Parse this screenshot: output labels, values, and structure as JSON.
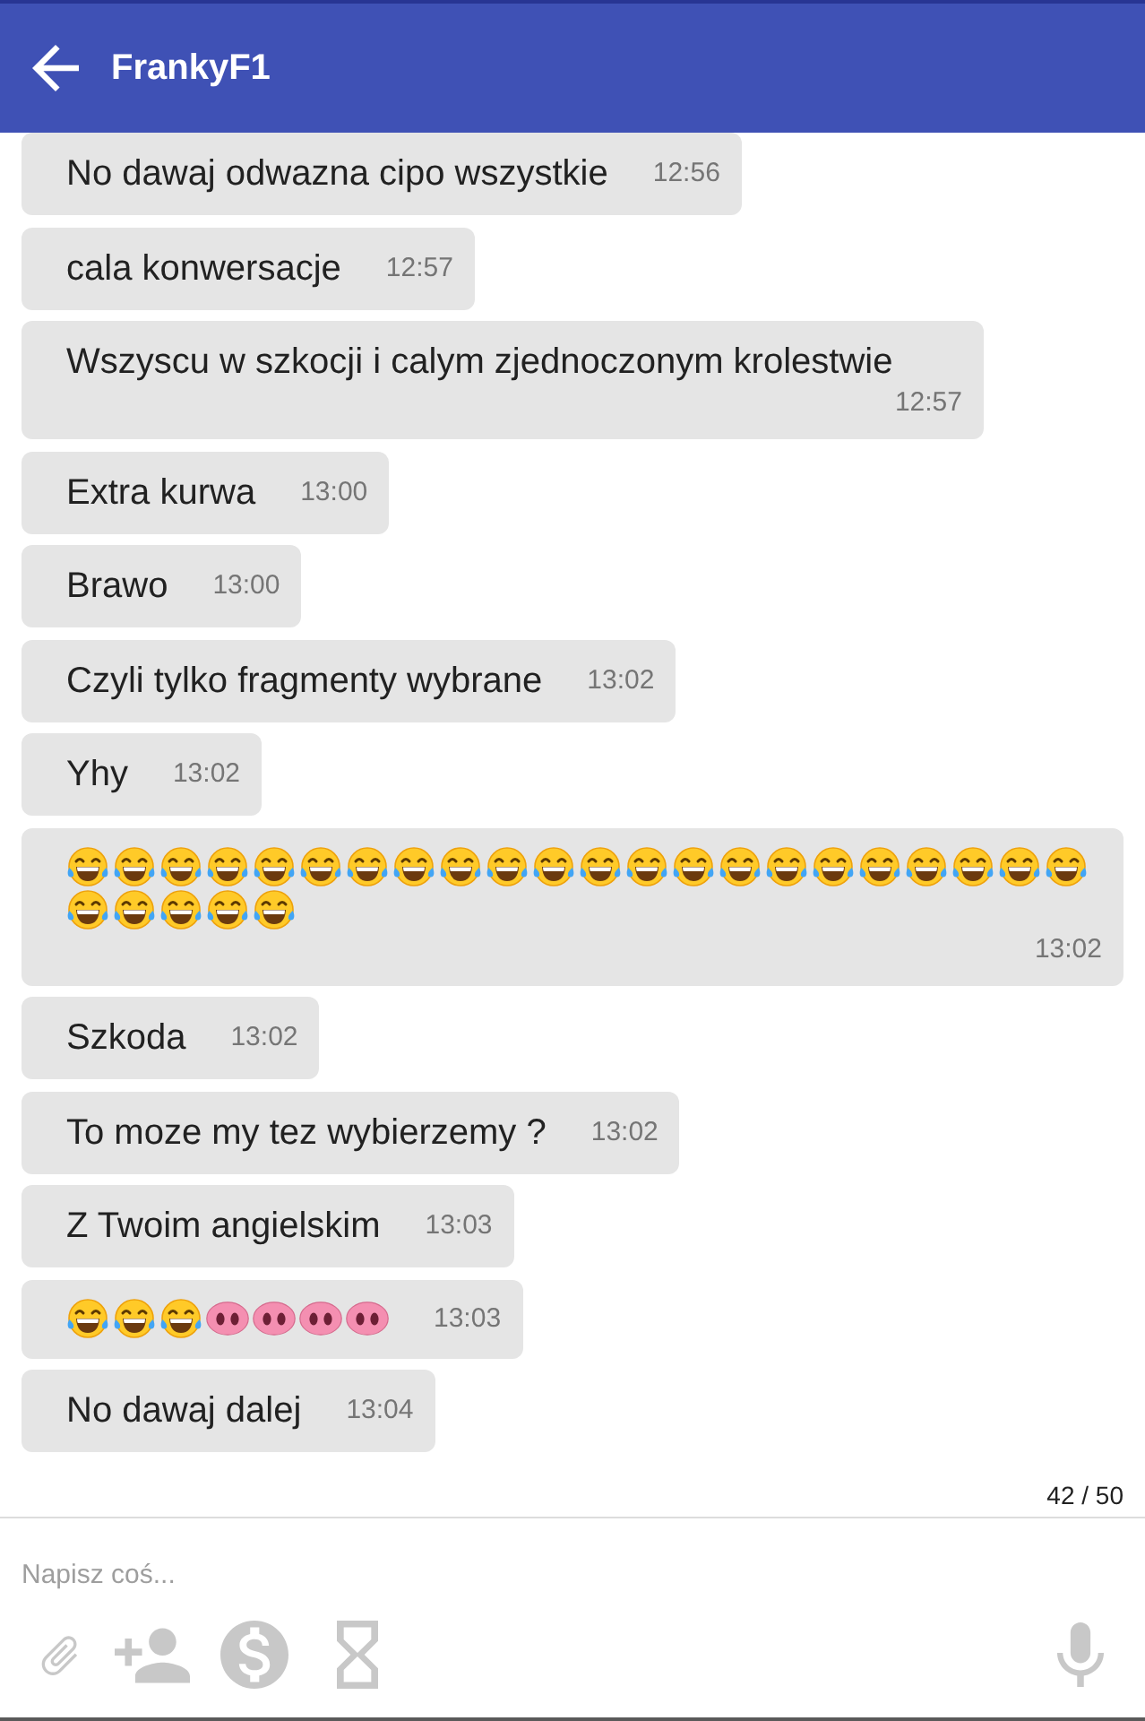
{
  "app_bar": {
    "title": "FrankyF1"
  },
  "messages": [
    {
      "kind": "text",
      "text": "No dawaj odwazna cipo wszystkie",
      "time": "12:56"
    },
    {
      "kind": "text",
      "text": "cala konwersacje",
      "time": "12:57"
    },
    {
      "kind": "text",
      "text": "Wszyscu w szkocji i calym zjednoczonym krolestwie",
      "time": "12:57"
    },
    {
      "kind": "text",
      "text": "Extra kurwa",
      "time": "13:00"
    },
    {
      "kind": "text",
      "text": "Brawo",
      "time": "13:00"
    },
    {
      "kind": "text",
      "text": "Czyli tylko fragmenty wybrane",
      "time": "13:02"
    },
    {
      "kind": "text",
      "text": "Yhy",
      "time": "13:02"
    },
    {
      "kind": "emoji",
      "emojis": [
        {
          "kind": "laughing"
        },
        {
          "kind": "laughing"
        },
        {
          "kind": "laughing"
        },
        {
          "kind": "laughing"
        },
        {
          "kind": "laughing"
        },
        {
          "kind": "laughing"
        },
        {
          "kind": "laughing"
        },
        {
          "kind": "laughing"
        },
        {
          "kind": "laughing"
        },
        {
          "kind": "laughing"
        },
        {
          "kind": "laughing"
        },
        {
          "kind": "laughing"
        },
        {
          "kind": "laughing"
        },
        {
          "kind": "laughing"
        },
        {
          "kind": "laughing"
        },
        {
          "kind": "laughing"
        },
        {
          "kind": "laughing"
        },
        {
          "kind": "laughing"
        },
        {
          "kind": "laughing"
        },
        {
          "kind": "laughing"
        },
        {
          "kind": "laughing"
        },
        {
          "kind": "laughing"
        },
        {
          "kind": "laughing"
        },
        {
          "kind": "laughing"
        },
        {
          "kind": "laughing"
        },
        {
          "kind": "laughing"
        },
        {
          "kind": "laughing"
        }
      ],
      "time": "13:02"
    },
    {
      "kind": "text",
      "text": "Szkoda",
      "time": "13:02"
    },
    {
      "kind": "text",
      "text": "To moze my tez wybierzemy ?",
      "time": "13:02"
    },
    {
      "kind": "text",
      "text": "Z Twoim angielskim",
      "time": "13:03"
    },
    {
      "kind": "emoji",
      "emojis": [
        {
          "kind": "laughing"
        },
        {
          "kind": "laughing"
        },
        {
          "kind": "laughing"
        },
        {
          "kind": "pig_nose"
        },
        {
          "kind": "pig_nose"
        },
        {
          "kind": "pig_nose"
        },
        {
          "kind": "pig_nose"
        }
      ],
      "time": "13:03"
    },
    {
      "kind": "text",
      "text": "No dawaj dalej",
      "time": "13:04"
    }
  ],
  "counter": "42 / 50",
  "composer": {
    "placeholder": "Napisz coś..."
  }
}
